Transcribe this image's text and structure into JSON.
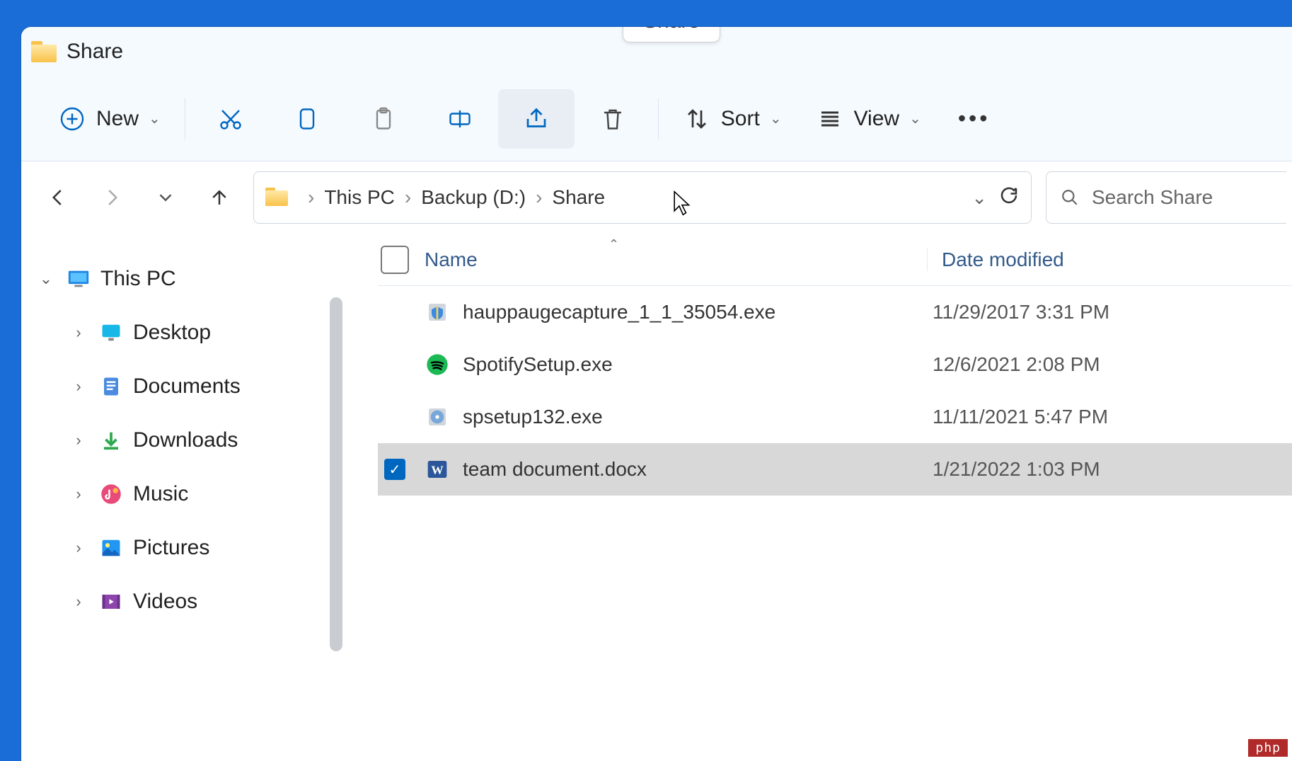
{
  "title": "Share",
  "tooltip": "Share",
  "toolbar": {
    "new_label": "New",
    "sort_label": "Sort",
    "view_label": "View"
  },
  "breadcrumbs": [
    "This PC",
    "Backup (D:)",
    "Share"
  ],
  "search_placeholder": "Search Share",
  "columns": {
    "name": "Name",
    "date": "Date modified"
  },
  "sidebar": {
    "root": "This PC",
    "items": [
      {
        "label": "Desktop",
        "icon": "desktop"
      },
      {
        "label": "Documents",
        "icon": "documents"
      },
      {
        "label": "Downloads",
        "icon": "downloads"
      },
      {
        "label": "Music",
        "icon": "music"
      },
      {
        "label": "Pictures",
        "icon": "pictures"
      },
      {
        "label": "Videos",
        "icon": "videos"
      }
    ]
  },
  "files": [
    {
      "name": "hauppaugecapture_1_1_35054.exe",
      "date": "11/29/2017 3:31 PM",
      "icon": "exe-shield",
      "selected": false
    },
    {
      "name": "SpotifySetup.exe",
      "date": "12/6/2021 2:08 PM",
      "icon": "spotify",
      "selected": false
    },
    {
      "name": "spsetup132.exe",
      "date": "11/11/2021 5:47 PM",
      "icon": "exe-disc",
      "selected": false
    },
    {
      "name": "team document.docx",
      "date": "1/21/2022 1:03 PM",
      "icon": "word",
      "selected": true
    }
  ],
  "watermark": "php"
}
